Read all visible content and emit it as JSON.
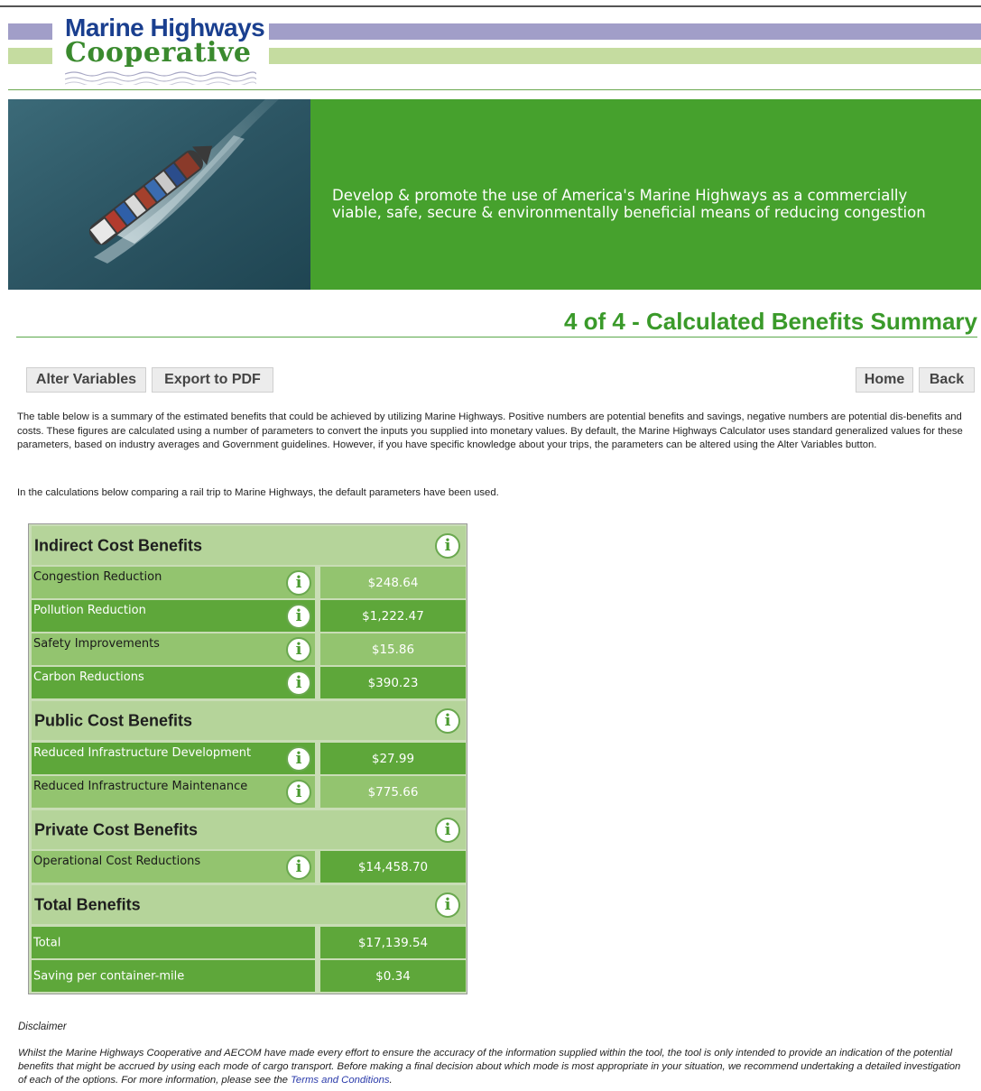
{
  "logo": {
    "line1": "Marine Highways",
    "line2": "Cooperative"
  },
  "banner": {
    "tagline_line1": "Develop & promote the use of America's Marine Highways as a commercially",
    "tagline_line2": "viable, safe, secure & environmentally beneficial means of reducing congestion"
  },
  "page": {
    "title": "4 of 4 - Calculated Benefits Summary"
  },
  "toolbar": {
    "alter_label": "Alter Variables",
    "export_label": "Export to PDF",
    "home_label": "Home",
    "back_label": "Back"
  },
  "intro": {
    "p1": "The table below is a summary of the estimated benefits that could be achieved by utilizing Marine Highways. Positive numbers are potential benefits and savings, negative numbers are potential dis-benefits and costs. These figures are calculated using a number of parameters to convert the inputs you supplied into monetary values. By default, the Marine Highways Calculator uses standard generalized values for these parameters, based on industry averages and Government guidelines. However, if you have specific knowledge about your trips, the parameters can be altered using the Alter Variables button.",
    "p2": "In the calculations below comparing a rail trip to Marine Highways, the default parameters have been used."
  },
  "table": {
    "indirect": {
      "title": "Indirect Cost Benefits",
      "rows": [
        {
          "label": "Congestion Reduction",
          "value": "$248.64"
        },
        {
          "label": "Pollution Reduction",
          "value": "$1,222.47"
        },
        {
          "label": "Safety Improvements",
          "value": "$15.86"
        },
        {
          "label": "Carbon Reductions",
          "value": "$390.23"
        }
      ]
    },
    "public": {
      "title": "Public Cost Benefits",
      "rows": [
        {
          "label": "Reduced Infrastructure Development",
          "value": "$27.99"
        },
        {
          "label": "Reduced Infrastructure Maintenance",
          "value": "$775.66"
        }
      ]
    },
    "private": {
      "title": "Private Cost Benefits",
      "rows": [
        {
          "label": "Operational Cost Reductions",
          "value": "$14,458.70"
        }
      ]
    },
    "total": {
      "title": "Total Benefits",
      "rows": [
        {
          "label": "Total",
          "value": "$17,139.54"
        },
        {
          "label": "Saving per container-mile",
          "value": "$0.34"
        }
      ]
    },
    "info_glyph": "i"
  },
  "disclaimer": {
    "heading": "Disclaimer",
    "text": "Whilst the Marine Highways Cooperative and AECOM have made every effort to ensure the accuracy of the information supplied within the tool, the tool is only intended to provide an indication of the potential benefits that might be accrued by using each mode of cargo transport. Before making a final decision about which mode is most appropriate in your situation, we recommend undertaking a detailed investigation of each of the options. For more information, please see the",
    "link": "Terms and Conditions",
    "end": "."
  },
  "colors": {
    "brand_green": "#46a12d",
    "brand_blue": "#1a3f8f",
    "row_light": "#93c46f",
    "row_dark": "#5ea73a",
    "section_header": "#b5d49a"
  },
  "icons": [
    "info-icon",
    "ship-photo",
    "logo-wave"
  ]
}
